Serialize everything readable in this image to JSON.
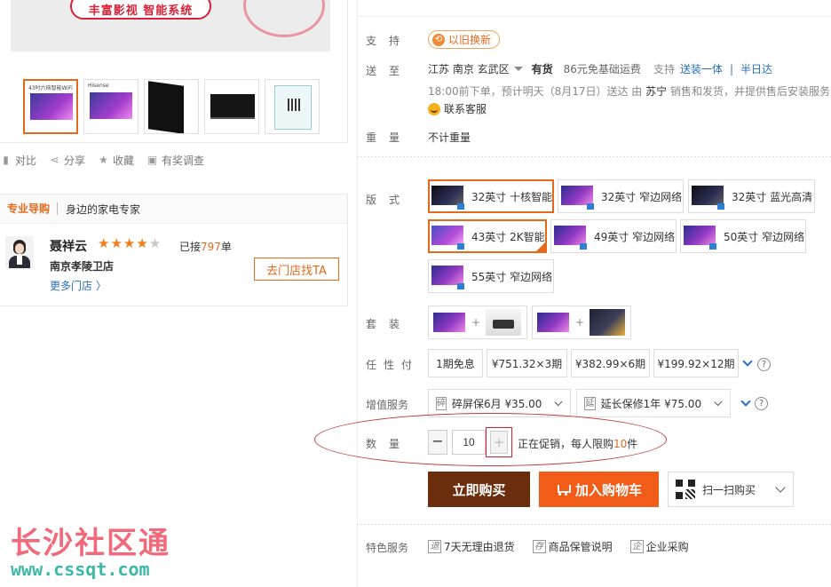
{
  "banner": {
    "slogan": "丰富影视 智能系统"
  },
  "thumbs": [
    {
      "label": "43吋六核智能WiFi",
      "kind": "screen"
    },
    {
      "label": "Hisense",
      "kind": "screen"
    },
    {
      "label": "",
      "kind": "side"
    },
    {
      "label": "",
      "kind": "back"
    },
    {
      "label": "",
      "kind": "qr"
    }
  ],
  "actions": {
    "compare": "对比",
    "share": "分享",
    "favorite": "收藏",
    "survey": "有奖调查"
  },
  "guide": {
    "title": "专业导购",
    "subtitle": "身边的家电专家",
    "name": "聂祥云",
    "stars_on": "★★★★",
    "stars_off": "★",
    "served_prefix": "已接",
    "served_count": "797",
    "served_suffix": "单",
    "store": "南京孝陵卫店",
    "more": "更多门店 〉",
    "goto": "去门店找TA"
  },
  "labels": {
    "support": "支持",
    "ship": "送至",
    "weight": "重量",
    "version": "版式",
    "bundle": "套装",
    "installment": "任性付",
    "value_added": "增值服务",
    "quantity": "数量",
    "features": "特色服务"
  },
  "support": {
    "tradein": "以旧换新"
  },
  "shipping": {
    "address": "江苏 南京 玄武区",
    "stock": "有货",
    "fee": "86元免基础运费",
    "support": "支持",
    "link1": "送装一体",
    "sep": "|",
    "link2": "半日达",
    "eta_prefix": "18:00前下单，预计明天（8月17日）送达   由 ",
    "seller": "苏宁",
    "eta_suffix": " 销售和发货，并提供售后安装服务",
    "service": "联系客服"
  },
  "weight": {
    "value": "不计重量"
  },
  "versions": [
    {
      "label": "32英寸 十核智能",
      "selected": true
    },
    {
      "label": "32英寸 窄边网络",
      "selected": false
    },
    {
      "label": "32英寸 蓝光高清",
      "selected": false
    },
    {
      "label": "43英寸 2K智能",
      "selected": true
    },
    {
      "label": "49英寸 窄边网络",
      "selected": false
    },
    {
      "label": "50英寸 窄边网络",
      "selected": false
    },
    {
      "label": "55英寸 窄边网络",
      "selected": false
    }
  ],
  "bundles": {
    "plus": "+"
  },
  "installments": [
    {
      "label": "1期免息"
    },
    {
      "label": "¥751.32×3期"
    },
    {
      "label": "¥382.99×6期"
    },
    {
      "label": "¥199.92×12期"
    }
  ],
  "help": "?",
  "value_added": [
    {
      "tag": "碎",
      "label": "碎屏保6月 ¥35.00"
    },
    {
      "tag": "延",
      "label": "延长保修1年 ¥75.00"
    }
  ],
  "quantity": {
    "minus": "−",
    "value": "10",
    "plus": "+",
    "promo_prefix": "正在促销，每人限购",
    "promo_limit": "10",
    "promo_suffix": "件"
  },
  "buttons": {
    "buy": "立即购买",
    "cart": "加入购物车",
    "scan": "扫一扫购买"
  },
  "features": [
    {
      "tag": "退",
      "label": "7天无理由退货"
    },
    {
      "tag": "存",
      "label": "商品保管说明"
    },
    {
      "tag": "企",
      "label": "企业采购"
    }
  ],
  "watermark": {
    "line1": "长沙社区通",
    "line2": "www.cssqt.com"
  },
  "colors": {
    "accent": "#e3691d",
    "buy": "#6b2d0b",
    "cart": "#f25c19",
    "link": "#2a6ebb"
  }
}
